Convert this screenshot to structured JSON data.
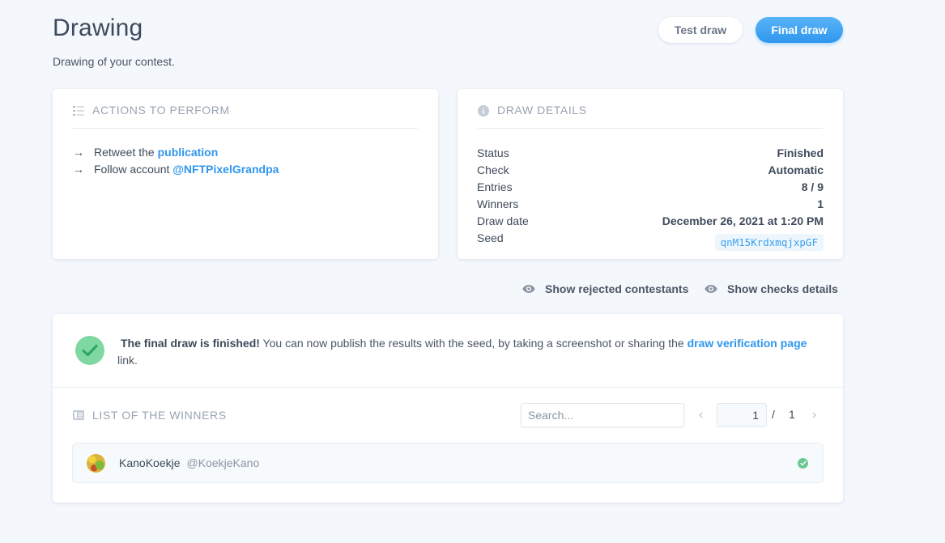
{
  "header": {
    "title": "Drawing",
    "subtitle": "Drawing of your contest.",
    "test_draw_label": "Test draw",
    "final_draw_label": "Final draw"
  },
  "actions_card": {
    "title": "ACTIONS TO PERFORM",
    "items": [
      {
        "prefix": "Retweet the",
        "link": "publication"
      },
      {
        "prefix": "Follow account",
        "link": "@NFTPixelGrandpa"
      }
    ]
  },
  "details_card": {
    "title": "DRAW DETAILS",
    "rows": [
      {
        "key": "Status",
        "value": "Finished"
      },
      {
        "key": "Check",
        "value": "Automatic"
      },
      {
        "key": "Entries",
        "value": "8 / 9"
      },
      {
        "key": "Winners",
        "value": "1"
      },
      {
        "key": "Draw date",
        "value": "December 26, 2021 at 1:20 PM"
      },
      {
        "key": "Seed",
        "value": "qnM15KrdxmqjxpGF"
      }
    ]
  },
  "options": {
    "show_rejected": "Show rejected contestants",
    "show_checks": "Show checks details"
  },
  "result": {
    "bold": "The final draw is finished!",
    "text": " You can now publish the results with the seed, by taking a screenshot or sharing the ",
    "link": "draw verification page",
    "suffix": " link."
  },
  "winners": {
    "title": "LIST OF THE WINNERS",
    "search_placeholder": "Search...",
    "page_current": "1",
    "page_sep": "/",
    "page_total": "1",
    "list": [
      {
        "name": "KanoKoekje",
        "handle": "@KoekjeKano"
      }
    ]
  },
  "colors": {
    "accent": "#2f97ee",
    "success": "#7fd8a2",
    "background": "#f4f8fd"
  }
}
